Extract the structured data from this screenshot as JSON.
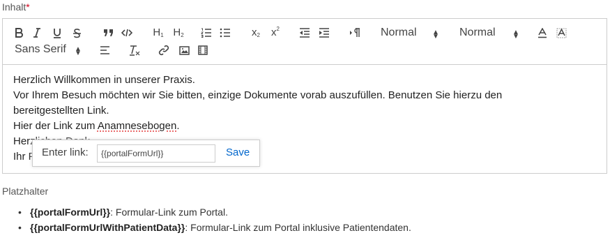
{
  "field": {
    "label": "Inhalt",
    "required_mark": "*"
  },
  "toolbar": {
    "header1": "H",
    "header2": "H",
    "header_sub1": "1",
    "header_sub2": "2",
    "heading_select": "Normal",
    "size_select": "Normal",
    "font_select": "Sans Serif",
    "subscript_base": "x",
    "subscript_mark": "2",
    "superscript_base": "x",
    "superscript_mark": "2",
    "icons": [
      "bold-icon",
      "italic-icon",
      "underline-icon",
      "strike-icon",
      "blockquote-icon",
      "code-block-icon",
      "ordered-list-icon",
      "bullet-list-icon",
      "outdent-icon",
      "indent-icon",
      "text-direction-icon",
      "font-color-icon",
      "background-color-icon",
      "align-icon",
      "clean-format-icon",
      "link-icon",
      "image-icon",
      "video-icon"
    ]
  },
  "content": {
    "line1": "Herzlich Willkommen in unserer Praxis.",
    "line2": "Vor Ihrem Besuch möchten wir Sie bitten, einzige Dokumente vorab auszufüllen. Benutzen Sie hierzu den",
    "line3": "bereitgestellten Link.",
    "line4_pre": "Hier der Link zum ",
    "line4_word": "Anamnesebogen",
    "line4_post": ".",
    "line5": "Herzlichen Dank",
    "line6": "Ihr Praxisteam"
  },
  "link_tooltip": {
    "label": "Enter link:",
    "value": "{{portalFormUrl}}",
    "save": "Save"
  },
  "placeholders": {
    "title": "Platzhalter",
    "items": [
      {
        "key": "{{portalFormUrl}}",
        "desc": ": Formular-Link zum Portal."
      },
      {
        "key": "{{portalFormUrlWithPatientData}}",
        "desc": ": Formular-Link zum Portal inklusive Patientendaten."
      }
    ]
  },
  "colors": {
    "link": "#0066cc",
    "border": "#cccccc",
    "required": "#d0021b"
  }
}
